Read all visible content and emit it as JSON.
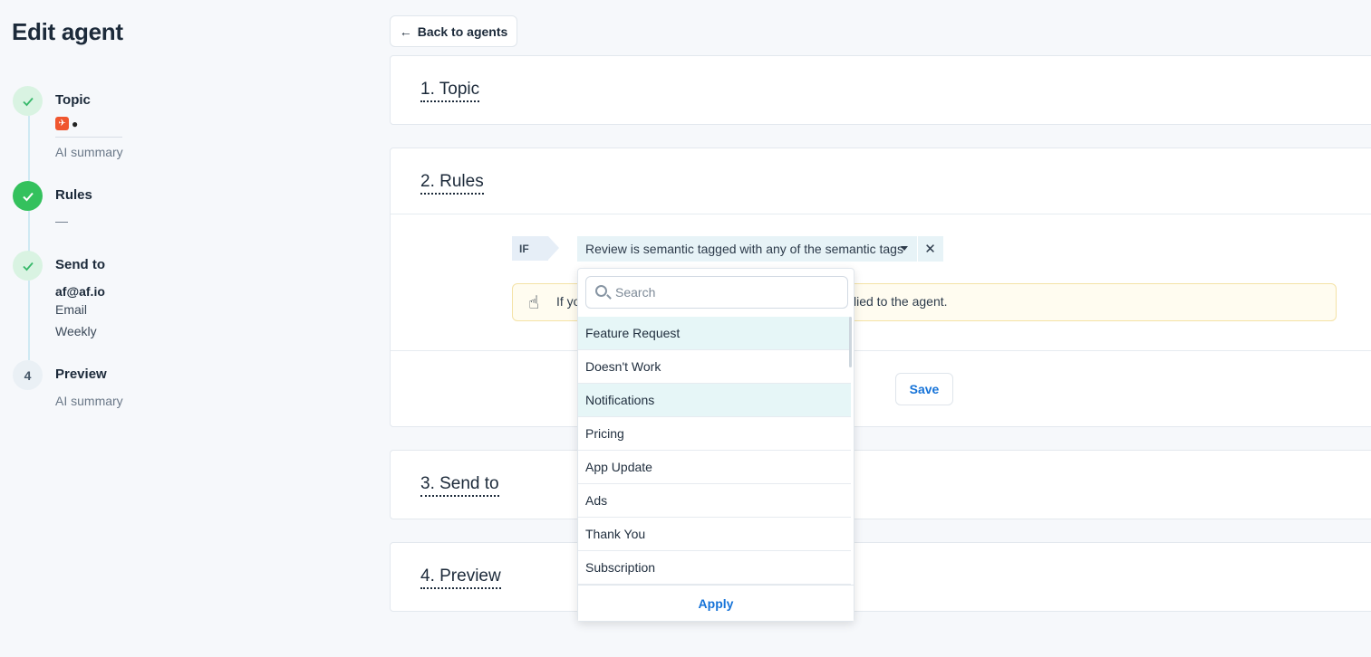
{
  "page": {
    "title": "Edit agent"
  },
  "stepper": {
    "steps": [
      {
        "number": "",
        "title": "Topic",
        "subtitle": "AI summary",
        "icon": "check-icon"
      },
      {
        "number": "",
        "title": "Rules",
        "subtitle": "—",
        "icon": "check-icon"
      },
      {
        "number": "",
        "title": "Send to",
        "email": "af@af.io",
        "channel": "Email",
        "frequency": "Weekly",
        "icon": "check-icon"
      },
      {
        "number": "4",
        "title": "Preview",
        "subtitle": "AI summary"
      }
    ]
  },
  "header": {
    "back_label": "Back to agents",
    "back_arrow": "←"
  },
  "sections": [
    {
      "title": "1. Topic"
    },
    {
      "title": "2. Rules"
    },
    {
      "title": "3. Send to"
    },
    {
      "title": "4. Preview"
    }
  ],
  "rules": {
    "if_label": "IF",
    "condition_text": "Review is semantic tagged with any of the semantic tags",
    "remove_glyph": "✕",
    "info_icon": "☝",
    "info_text_left": "If yo",
    "info_text_right": "lied to the agent.",
    "save_label": "Save"
  },
  "dropdown": {
    "search_placeholder": "Search",
    "items": [
      {
        "label": "Feature Request",
        "selected": true
      },
      {
        "label": "Doesn't Work",
        "selected": false
      },
      {
        "label": "Notifications",
        "selected": true
      },
      {
        "label": "Pricing",
        "selected": false
      },
      {
        "label": "App Update",
        "selected": false
      },
      {
        "label": "Ads",
        "selected": false
      },
      {
        "label": "Thank You",
        "selected": false
      },
      {
        "label": "Subscription",
        "selected": false
      }
    ],
    "apply_label": "Apply"
  },
  "colors": {
    "accent_blue": "#1673d8",
    "success_green": "#34c15d",
    "selected_row": "#e6f6f7",
    "condition_bg": "#e7f3f7"
  }
}
